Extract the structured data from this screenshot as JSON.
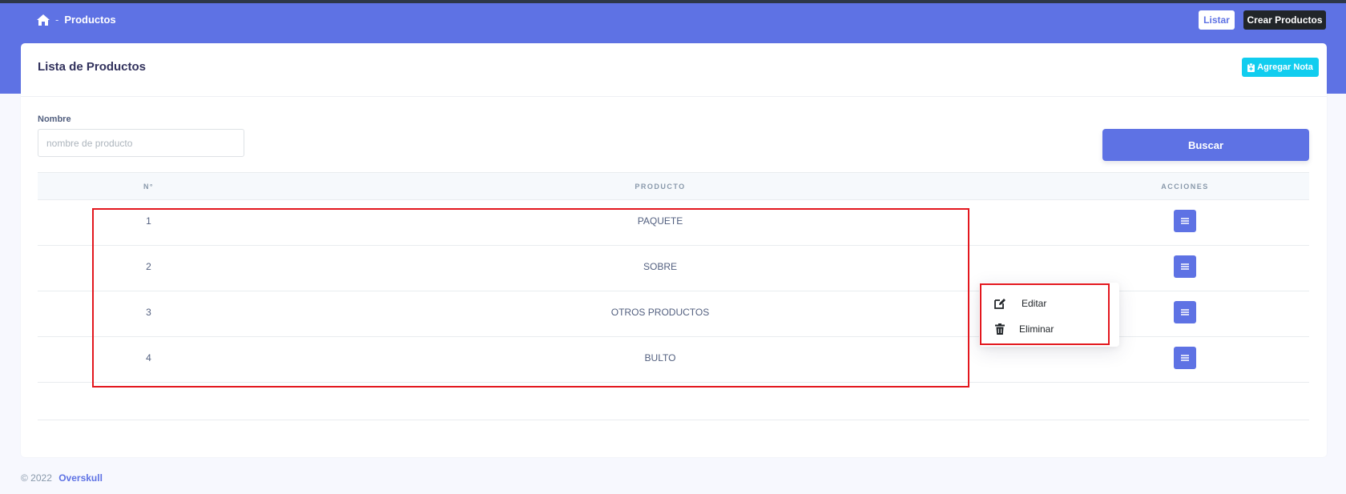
{
  "breadcrumb": {
    "separator": "-",
    "current": "Productos"
  },
  "header": {
    "listar_label": "Listar",
    "crear_label": "Crear Productos"
  },
  "card": {
    "title": "Lista de Productos",
    "agregar_label": "Agregar Nota"
  },
  "filter": {
    "label": "Nombre",
    "placeholder": "nombre de producto",
    "value": "",
    "search_label": "Buscar"
  },
  "table": {
    "headers": [
      "N°",
      "PRODUCTO",
      "ACCIONES"
    ],
    "rows": [
      {
        "n": "1",
        "producto": "PAQUETE"
      },
      {
        "n": "2",
        "producto": "SOBRE"
      },
      {
        "n": "3",
        "producto": "OTROS PRODUCTOS"
      },
      {
        "n": "4",
        "producto": "BULTO"
      }
    ]
  },
  "dropdown": {
    "items": [
      {
        "label": "Editar",
        "icon": "edit-icon"
      },
      {
        "label": "Eliminar",
        "icon": "trash-icon"
      }
    ]
  },
  "footer": {
    "copyright": "© 2022",
    "brand": "Overskull"
  },
  "colors": {
    "primary": "#5e72e4",
    "info": "#11cdef",
    "dark": "#212529",
    "highlight": "#e3171e"
  }
}
